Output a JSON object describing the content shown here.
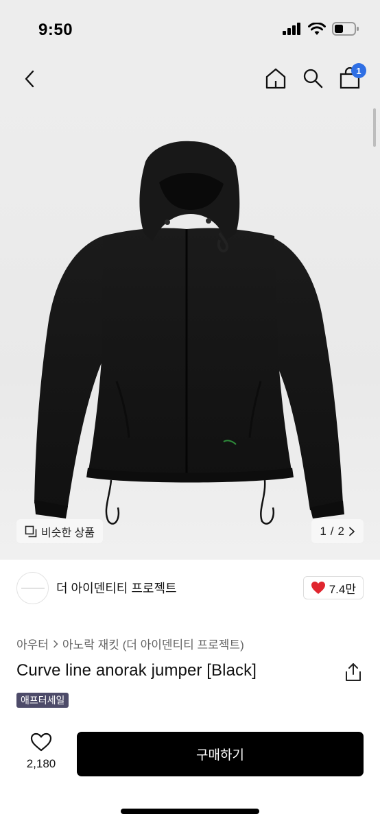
{
  "status_bar": {
    "time": "9:50"
  },
  "header": {
    "cart_count": "1"
  },
  "gallery": {
    "similar_label": "비슷한 상품",
    "page_current": "1",
    "page_separator": "/",
    "page_total": "2"
  },
  "brand": {
    "name": "더 아이덴티티 프로젝트",
    "likes": "7.4만"
  },
  "product": {
    "breadcrumb": [
      "아우터",
      "아노락 재킷 (더 아이덴티티 프로젝트)"
    ],
    "title": "Curve line anorak jumper [Black]",
    "badge": "애프터세일"
  },
  "footer": {
    "wish_count": "2,180",
    "buy_label": "구매하기"
  },
  "colors": {
    "accent_badge": "#2f6fe4",
    "sale_badge": "#4d4b69",
    "like_heart": "#e0262f",
    "buy_button": "#000000"
  }
}
